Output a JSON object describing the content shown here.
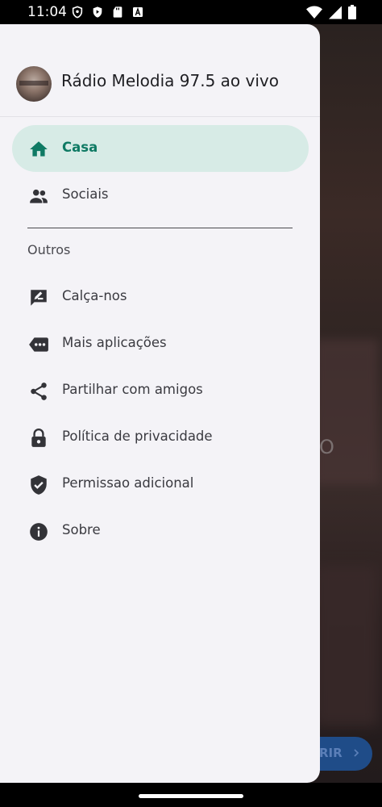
{
  "status_bar": {
    "time": "11:04",
    "left_icons": [
      "vpn-shield-icon",
      "play-protect-icon",
      "sd-card-icon",
      "a-badge-icon"
    ],
    "right_icons": [
      "wifi-icon",
      "signal-icon",
      "battery-icon"
    ]
  },
  "drawer": {
    "app_title": "Rádio Melodia 97.5 ao vivo",
    "primary_items": [
      {
        "label": "Casa",
        "icon": "home-icon",
        "active": true
      },
      {
        "label": "Sociais",
        "icon": "people-icon",
        "active": false
      }
    ],
    "section_title": "Outros",
    "other_items": [
      {
        "label": "Calça-nos",
        "icon": "rate-feedback-icon"
      },
      {
        "label": "Mais aplicações",
        "icon": "more-apps-icon"
      },
      {
        "label": "Partilhar com amigos",
        "icon": "share-icon"
      },
      {
        "label": "Política de privacidade",
        "icon": "lock-icon"
      },
      {
        "label": "Permissao adicional",
        "icon": "verified-shield-icon"
      },
      {
        "label": "Sobre",
        "icon": "info-icon"
      }
    ]
  },
  "background": {
    "partial_button_text": "RIR",
    "partial_letter": "O"
  },
  "colors": {
    "accent": "#0f7a64",
    "active_bg": "#d7ebe6",
    "drawer_bg": "#f4f3f7",
    "icon": "#333338"
  }
}
